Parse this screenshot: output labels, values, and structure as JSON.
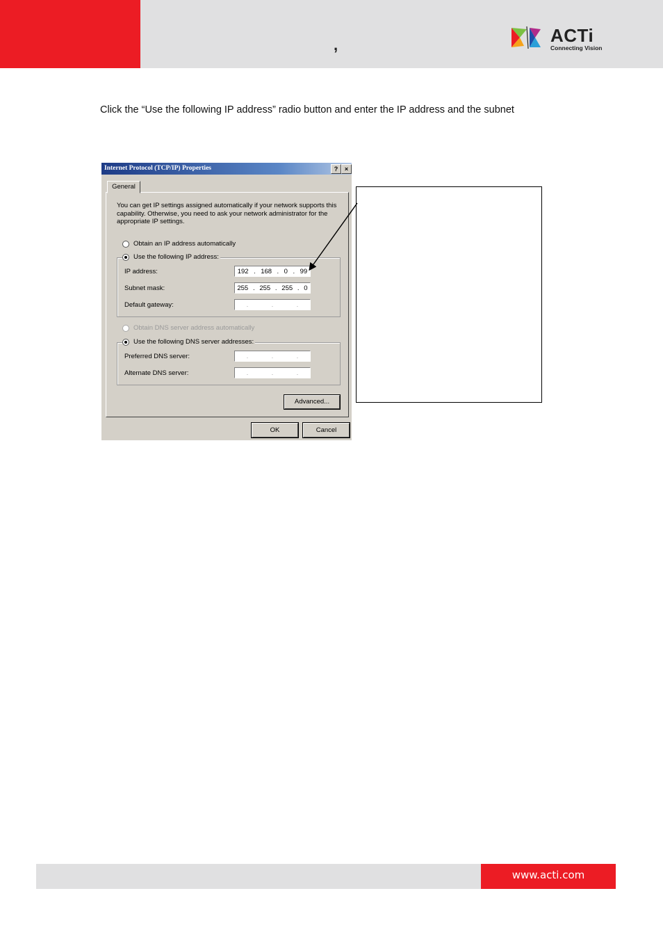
{
  "header": {
    "comma": ",",
    "logo": {
      "word": "ACTi",
      "tagline": "Connecting Vision"
    },
    "colors": {
      "red": "#ec1c24",
      "grey": "#e0e0e1"
    }
  },
  "instruction": "Click the “Use the following IP address” radio button and enter the IP address and the subnet",
  "dialog": {
    "title": "Internet Protocol (TCP/IP) Properties",
    "help_btn": "?",
    "close_btn": "×",
    "tab": "General",
    "description": "You can get IP settings assigned automatically if your network supports this capability. Otherwise, you need to ask your network administrator for the appropriate IP settings.",
    "radio_obtain_ip": "Obtain an IP address automatically",
    "radio_use_ip": "Use the following IP address:",
    "ip_label": "IP address:",
    "ip_value": [
      "192",
      "168",
      "0",
      "99"
    ],
    "subnet_label": "Subnet mask:",
    "subnet_value": [
      "255",
      "255",
      "255",
      "0"
    ],
    "gateway_label": "Default gateway:",
    "radio_obtain_dns": "Obtain DNS server address automatically",
    "radio_use_dns": "Use the following DNS server addresses:",
    "preferred_dns_label": "Preferred DNS server:",
    "alternate_dns_label": "Alternate DNS server:",
    "empty_ip": [
      ".",
      ".",
      "."
    ],
    "advanced_btn": "Advanced...",
    "ok_btn": "OK",
    "cancel_btn": "Cancel"
  },
  "footer": {
    "url": "www.acti.com"
  }
}
